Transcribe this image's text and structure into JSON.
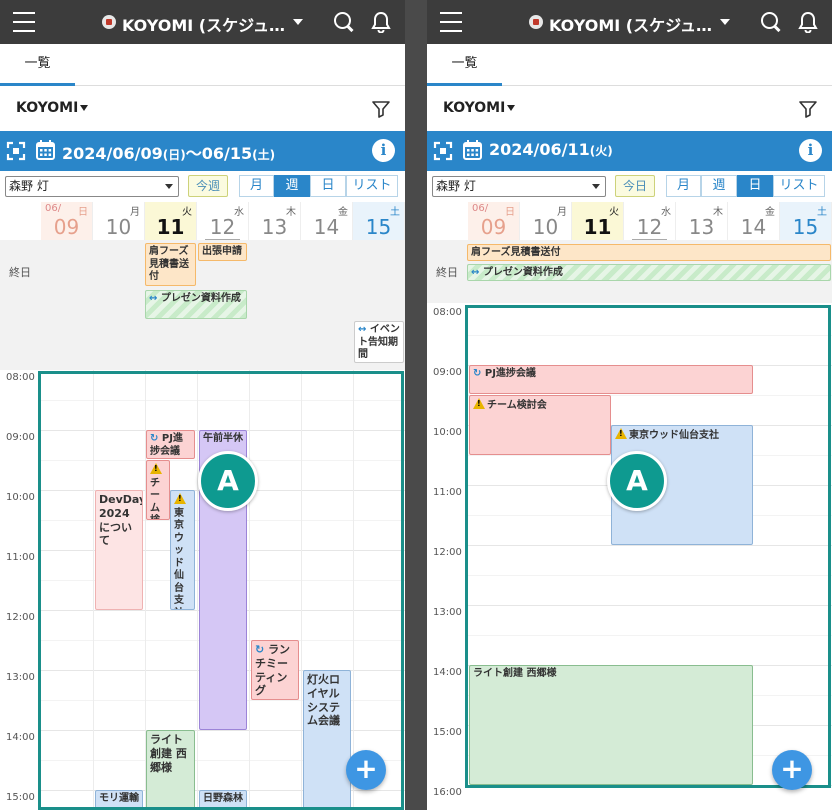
{
  "header": {
    "title": "KOYOMI (スケジュ…"
  },
  "tabs": [
    "一覧"
  ],
  "filter_label": "KOYOMI",
  "user_select": "森野 灯",
  "today_button": "今週",
  "today_button_right": "今日",
  "view_buttons": [
    "月",
    "週",
    "日",
    "リスト"
  ],
  "all_day_label": "終日",
  "week": {
    "range_start": "2024/06/09",
    "range_start_dow": "(日)",
    "range_sep": "～",
    "range_end": "06/15",
    "range_end_dow": "(土)",
    "month_label": "06/",
    "days": [
      {
        "dow": "日",
        "num": "09"
      },
      {
        "dow": "月",
        "num": "10"
      },
      {
        "dow": "火",
        "num": "11"
      },
      {
        "dow": "水",
        "num": "12"
      },
      {
        "dow": "木",
        "num": "13"
      },
      {
        "dow": "金",
        "num": "14"
      },
      {
        "dow": "土",
        "num": "15"
      }
    ],
    "times": [
      "08:00",
      "09:00",
      "10:00",
      "11:00",
      "12:00",
      "13:00",
      "14:00",
      "15:00"
    ],
    "all_day_events": [
      "肩フーズ見積書送付",
      "出張申請",
      "プレゼン資料作成",
      "イベント告知期間"
    ],
    "events": [
      "PJ進捗会議",
      "チーム検討会",
      "東京ウッド仙台支社",
      "午前半休",
      "DevDays 2024 について",
      "ランチミーティング",
      "灯火ロイヤル システム会議",
      "ライト創建 西郷様",
      "モリ運輸",
      "日野森林"
    ]
  },
  "day": {
    "date": "2024/06/11",
    "dow": "(火)",
    "times": [
      "08:00",
      "09:00",
      "10:00",
      "11:00",
      "12:00",
      "13:00",
      "14:00",
      "15:00",
      "16:00"
    ],
    "all_day_events": [
      "肩フーズ見積書送付",
      "プレゼン資料作成"
    ],
    "events": [
      "PJ進捗会議",
      "チーム検討会",
      "東京ウッド仙台支社",
      "ライト創建 西郷様"
    ]
  },
  "annotation": "A",
  "fab_label": "+",
  "colors": {
    "accent": "#2a86c9",
    "header": "#3c3c3c",
    "frame": "#1a8f8a",
    "badge": "#0e9a90"
  }
}
